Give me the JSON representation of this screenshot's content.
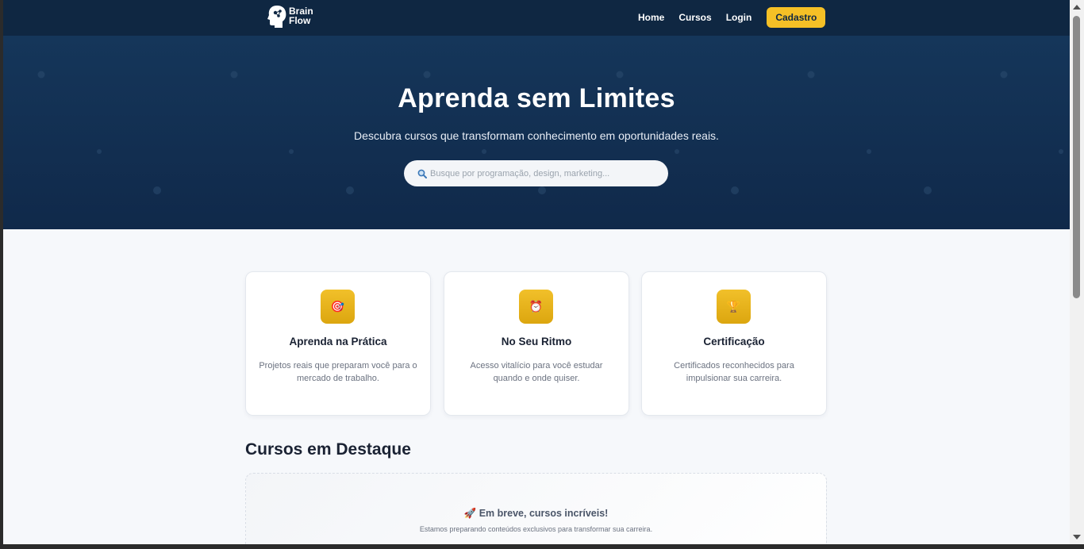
{
  "brand": {
    "line1": "Brain",
    "line2": "Flow"
  },
  "nav": {
    "home": "Home",
    "cursos": "Cursos",
    "login": "Login",
    "cadastro": "Cadastro"
  },
  "hero": {
    "title": "Aprenda sem Limites",
    "subtitle": "Descubra cursos que transformam conhecimento em oportunidades reais.",
    "search_placeholder": "Busque por programação, design, marketing...",
    "search_icon": "magnifier-icon"
  },
  "features": [
    {
      "icon": "target-icon",
      "glyph": "🎯",
      "title": "Aprenda na Prática",
      "text": "Projetos reais que preparam você para o mercado de trabalho."
    },
    {
      "icon": "alarm-clock-icon",
      "glyph": "⏰",
      "title": "No Seu Ritmo",
      "text": "Acesso vitalício para você estudar quando e onde quiser."
    },
    {
      "icon": "trophy-icon",
      "glyph": "🏆",
      "title": "Certificação",
      "text": "Certificados reconhecidos para impulsionar sua carreira."
    }
  ],
  "featured": {
    "title": "Cursos em Destaque",
    "coming_title": "🚀 Em breve, cursos incríveis!",
    "coming_text": "Estamos preparando conteúdos exclusivos para transformar sua carreira."
  },
  "colors": {
    "navy": "#0f2742",
    "accent": "#f5c026",
    "background": "#f6f8fb"
  }
}
